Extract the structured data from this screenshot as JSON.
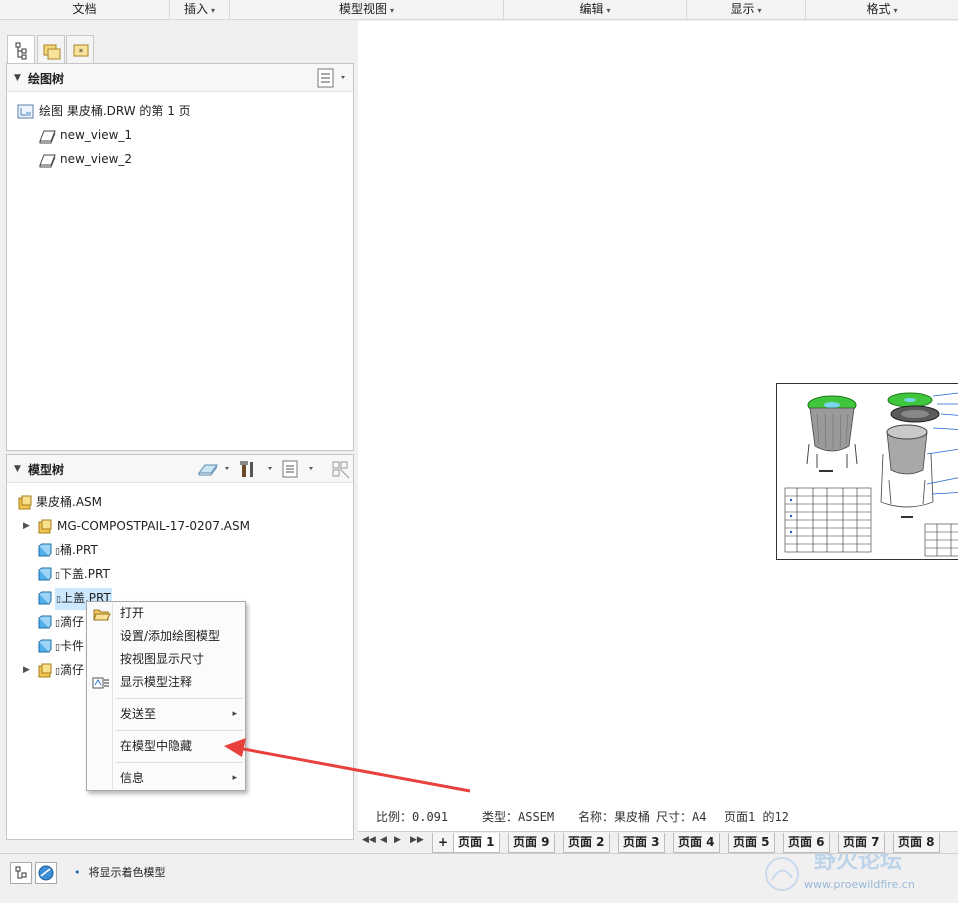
{
  "ribbon": {
    "groups": [
      "文档",
      "插入",
      "模型视图",
      "编辑",
      "显示",
      "格式"
    ],
    "dropdown_arrow": "▾"
  },
  "drawing_tree": {
    "title": "绘图树",
    "root": "绘图 果皮桶.DRW 的第 1 页",
    "views": [
      "new_view_1",
      "new_view_2"
    ]
  },
  "model_tree": {
    "title": "模型树",
    "root": "果皮桶.ASM",
    "items": [
      {
        "label": "MG-COMPOSTPAIL-17-0207.ASM",
        "expandable": true,
        "icon": "assembly-icon"
      },
      {
        "label": "桶.PRT",
        "expandable": false,
        "icon": "part-icon"
      },
      {
        "label": "下盖.PRT",
        "expandable": false,
        "icon": "part-icon"
      },
      {
        "label": "上盖.PRT",
        "expandable": false,
        "icon": "part-icon",
        "selected": true
      },
      {
        "label": "滴仔",
        "expandable": false,
        "icon": "part-icon"
      },
      {
        "label": "卡件",
        "expandable": false,
        "icon": "part-icon"
      },
      {
        "label": "滴仔",
        "expandable": true,
        "icon": "assembly-icon"
      }
    ]
  },
  "context_menu": {
    "items": [
      {
        "label": "打开",
        "icon": "open-folder-icon"
      },
      {
        "label": "设置/添加绘图模型"
      },
      {
        "label": "按视图显示尺寸"
      },
      {
        "label": "显示模型注释",
        "icon": "annotation-icon"
      },
      {
        "label": "发送至",
        "submenu": true
      },
      {
        "label": "在模型中隐藏"
      },
      {
        "label": "信息",
        "submenu": true
      }
    ],
    "submenu_arrow": "▸"
  },
  "title_block": {
    "scale": "比例：0.091",
    "type": "类型：ASSEM",
    "name": "名称：果皮桶",
    "size": "尺寸：A4",
    "page": "页面1 的12"
  },
  "page_tabs": {
    "add": "+",
    "tabs": [
      "页面 1",
      "页面 9",
      "页面 2",
      "页面 3",
      "页面 4",
      "页面 5",
      "页面 6",
      "页面 7",
      "页面 8"
    ],
    "active": 0
  },
  "status": {
    "message": "将显示着色模型"
  },
  "watermark": {
    "title": "野火论坛",
    "url": "www.proewildfire.cn"
  },
  "colors": {
    "selection": "#cce8ff",
    "arrow": "#e8403c",
    "part_cube": "#3aa1e0",
    "assembly_cube": "#e0b040"
  }
}
